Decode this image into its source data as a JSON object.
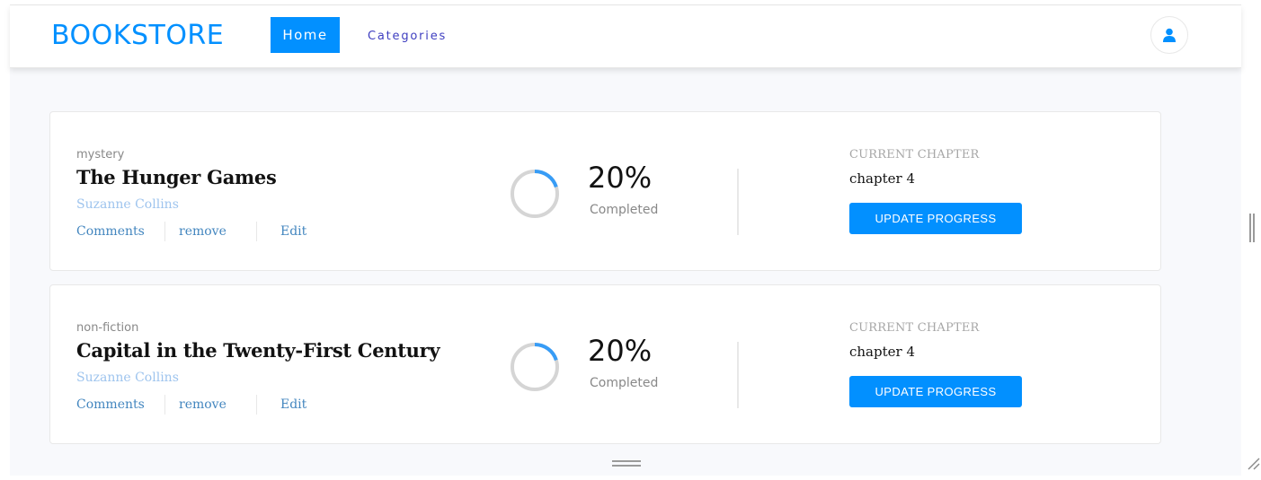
{
  "navbar": {
    "brand": "BOOKSTORE",
    "links": [
      {
        "label": "Home",
        "active": true
      },
      {
        "label": "Categories",
        "active": false
      }
    ],
    "user_icon": "user-icon"
  },
  "colors": {
    "accent": "#0290ff",
    "progress_track": "#d5d5d5",
    "progress_fill": "#379cf6",
    "author": "#9ec4ee",
    "action_link": "#4386bf"
  },
  "books": [
    {
      "genre": "mystery",
      "title": "The Hunger Games",
      "author": "Suzanne Collins",
      "actions": {
        "comments": "Comments",
        "remove": "remove",
        "edit": "Edit"
      },
      "progress_percent": 20,
      "percent_label": "20%",
      "completed_label": "Completed",
      "current_chapter_label": "CURRENT CHAPTER",
      "current_chapter": "chapter 4",
      "update_button": "UPDATE PROGRESS"
    },
    {
      "genre": "non-fiction",
      "title": "Capital in the Twenty-First Century",
      "author": "Suzanne Collins",
      "actions": {
        "comments": "Comments",
        "remove": "remove",
        "edit": "Edit"
      },
      "progress_percent": 20,
      "percent_label": "20%",
      "completed_label": "Completed",
      "current_chapter_label": "CURRENT CHAPTER",
      "current_chapter": "chapter 4",
      "update_button": "UPDATE PROGRESS"
    }
  ]
}
